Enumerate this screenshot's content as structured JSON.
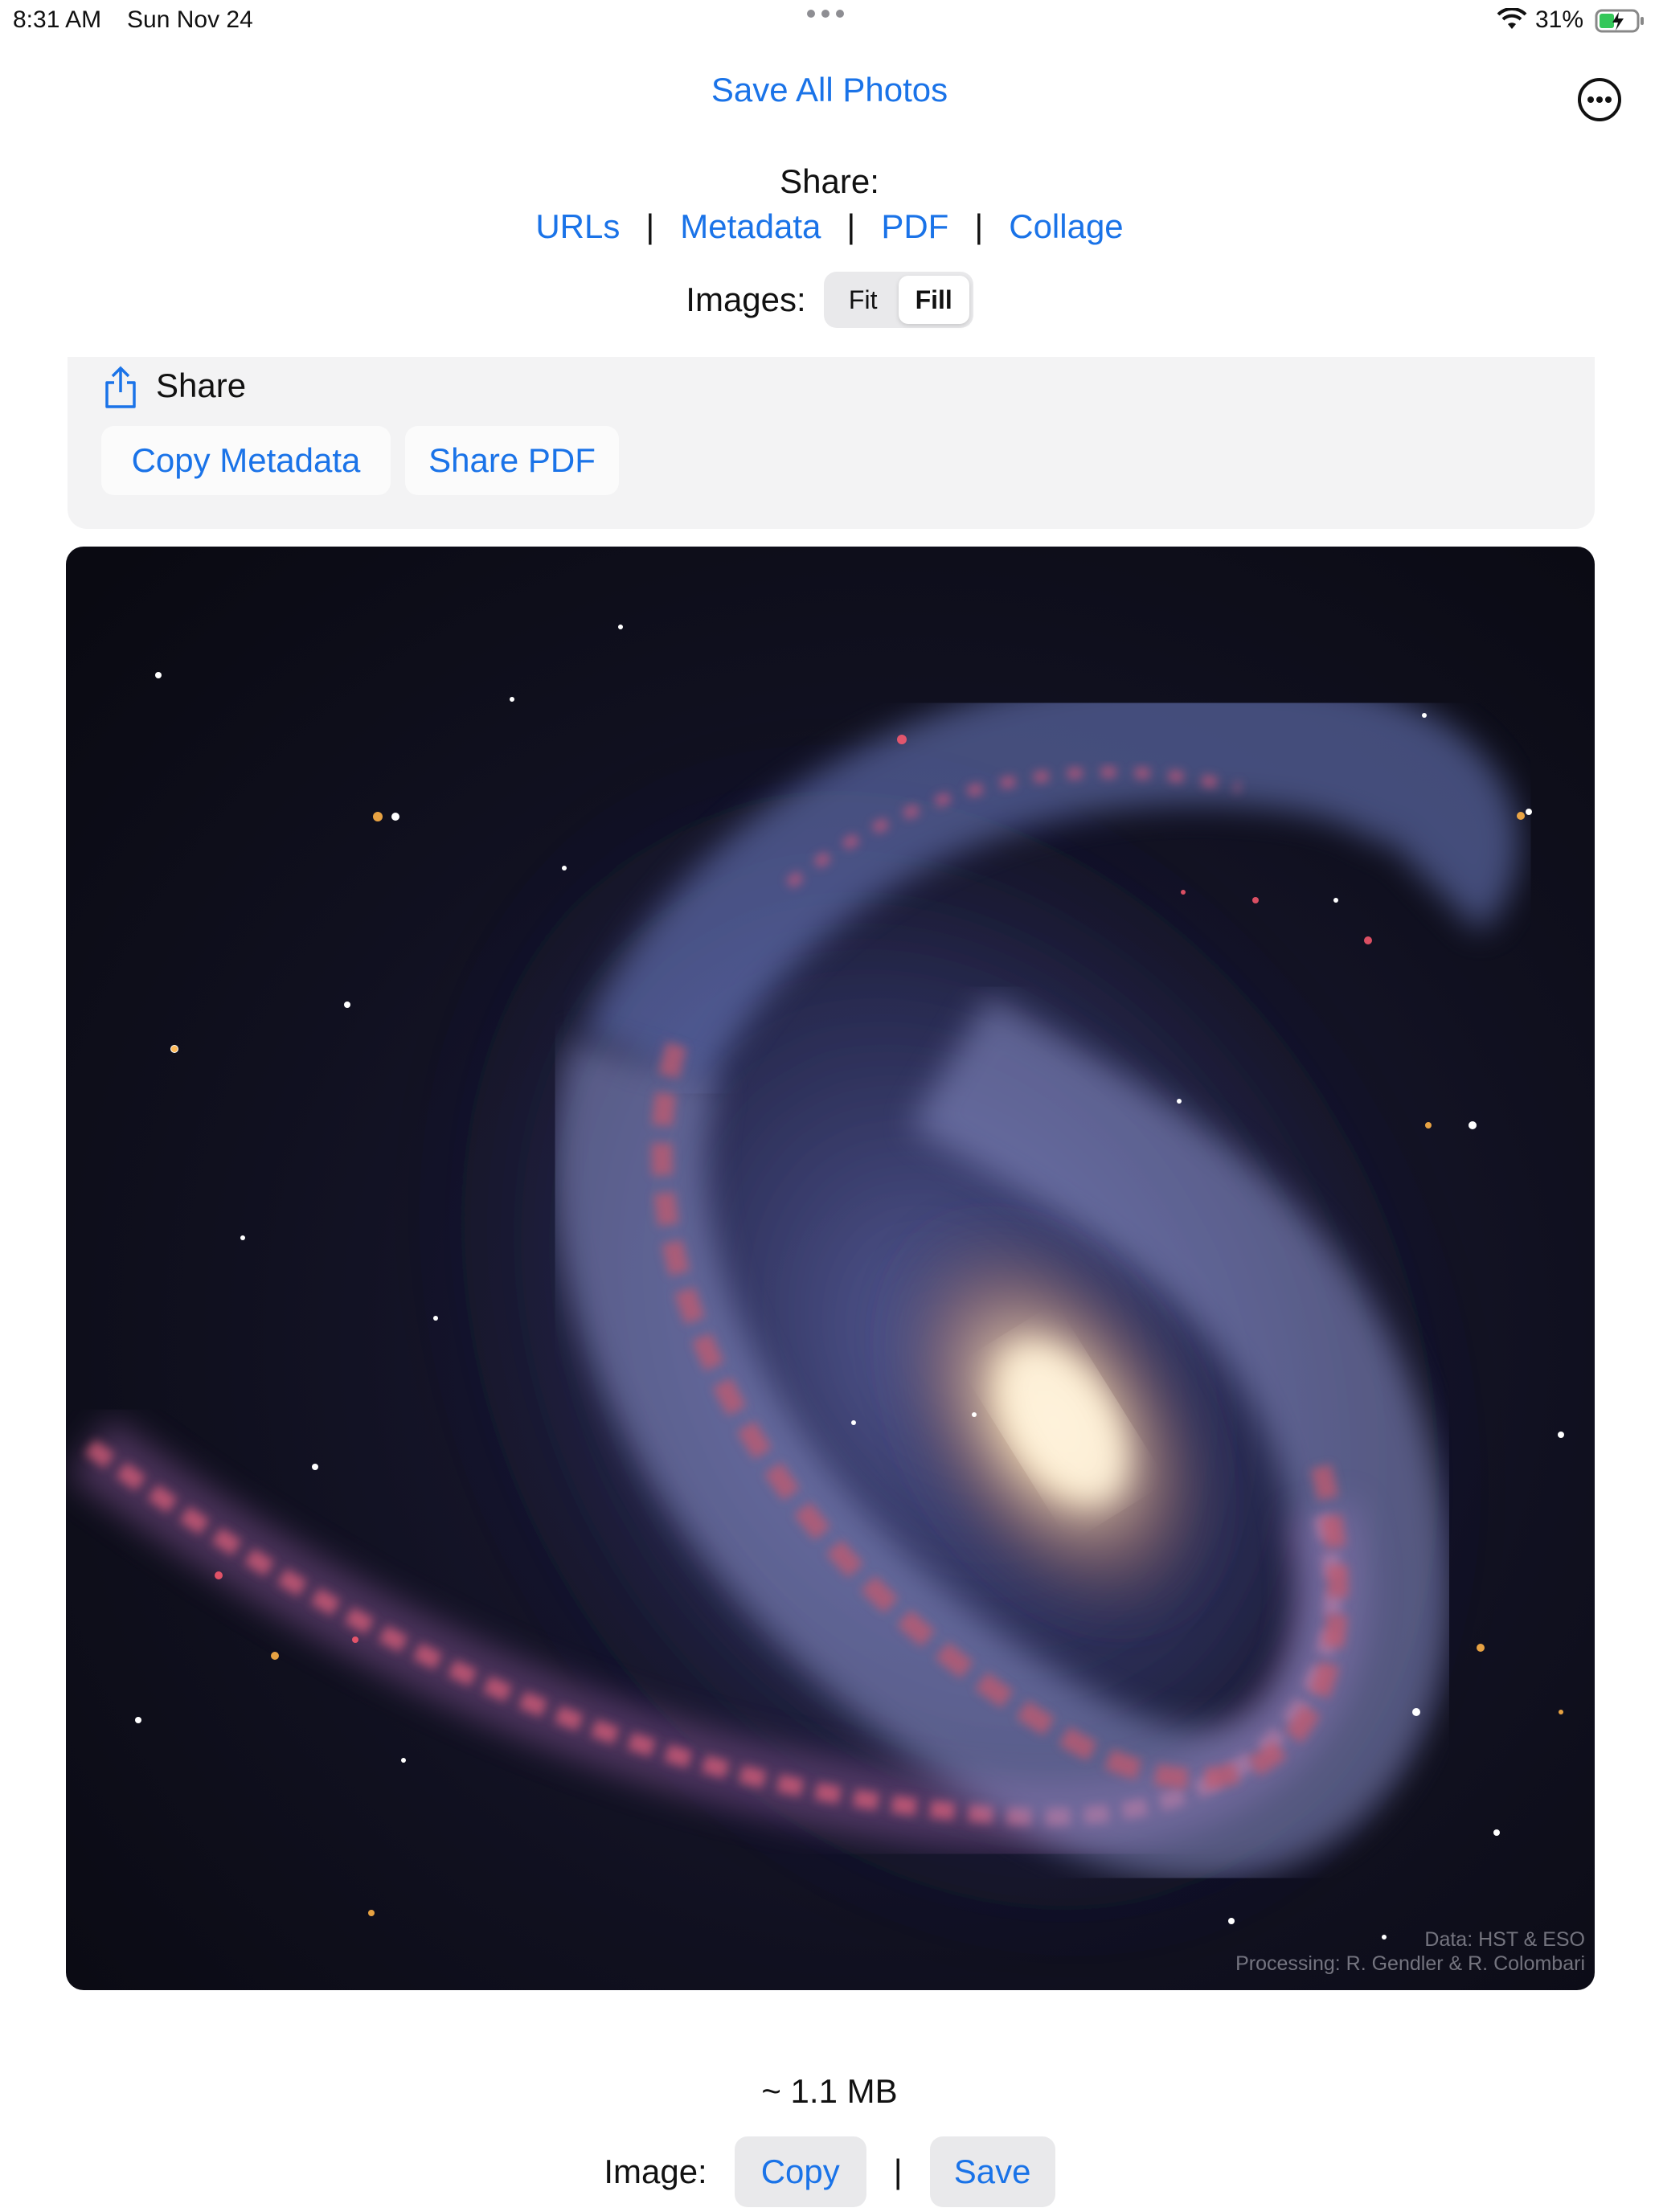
{
  "status_bar": {
    "time": "8:31 AM",
    "date": "Sun Nov 24",
    "battery_percent": "31%"
  },
  "header": {
    "title": "Save All Photos",
    "more_icon": "ellipsis-circle-icon"
  },
  "share": {
    "label": "Share:",
    "links": [
      "URLs",
      "Metadata",
      "PDF",
      "Collage"
    ],
    "separator": "|"
  },
  "images_mode": {
    "label": "Images:",
    "options": [
      "Fit",
      "Fill"
    ],
    "selected": "Fill"
  },
  "share_panel": {
    "icon": "share-icon",
    "title": "Share",
    "buttons": [
      "Copy Metadata",
      "Share PDF"
    ]
  },
  "photo": {
    "subject": "spiral galaxy",
    "credit_line1": "Data: HST & ESO",
    "credit_line2": "Processing: R. Gendler & R. Colombari"
  },
  "footer": {
    "size": "~ 1.1 MB",
    "image_label": "Image:",
    "copy_label": "Copy",
    "separator": "|",
    "save_label": "Save"
  },
  "colors": {
    "accent": "#1a73e8",
    "panel_bg": "#f3f3f4",
    "button_bg": "#e9e9eb"
  }
}
